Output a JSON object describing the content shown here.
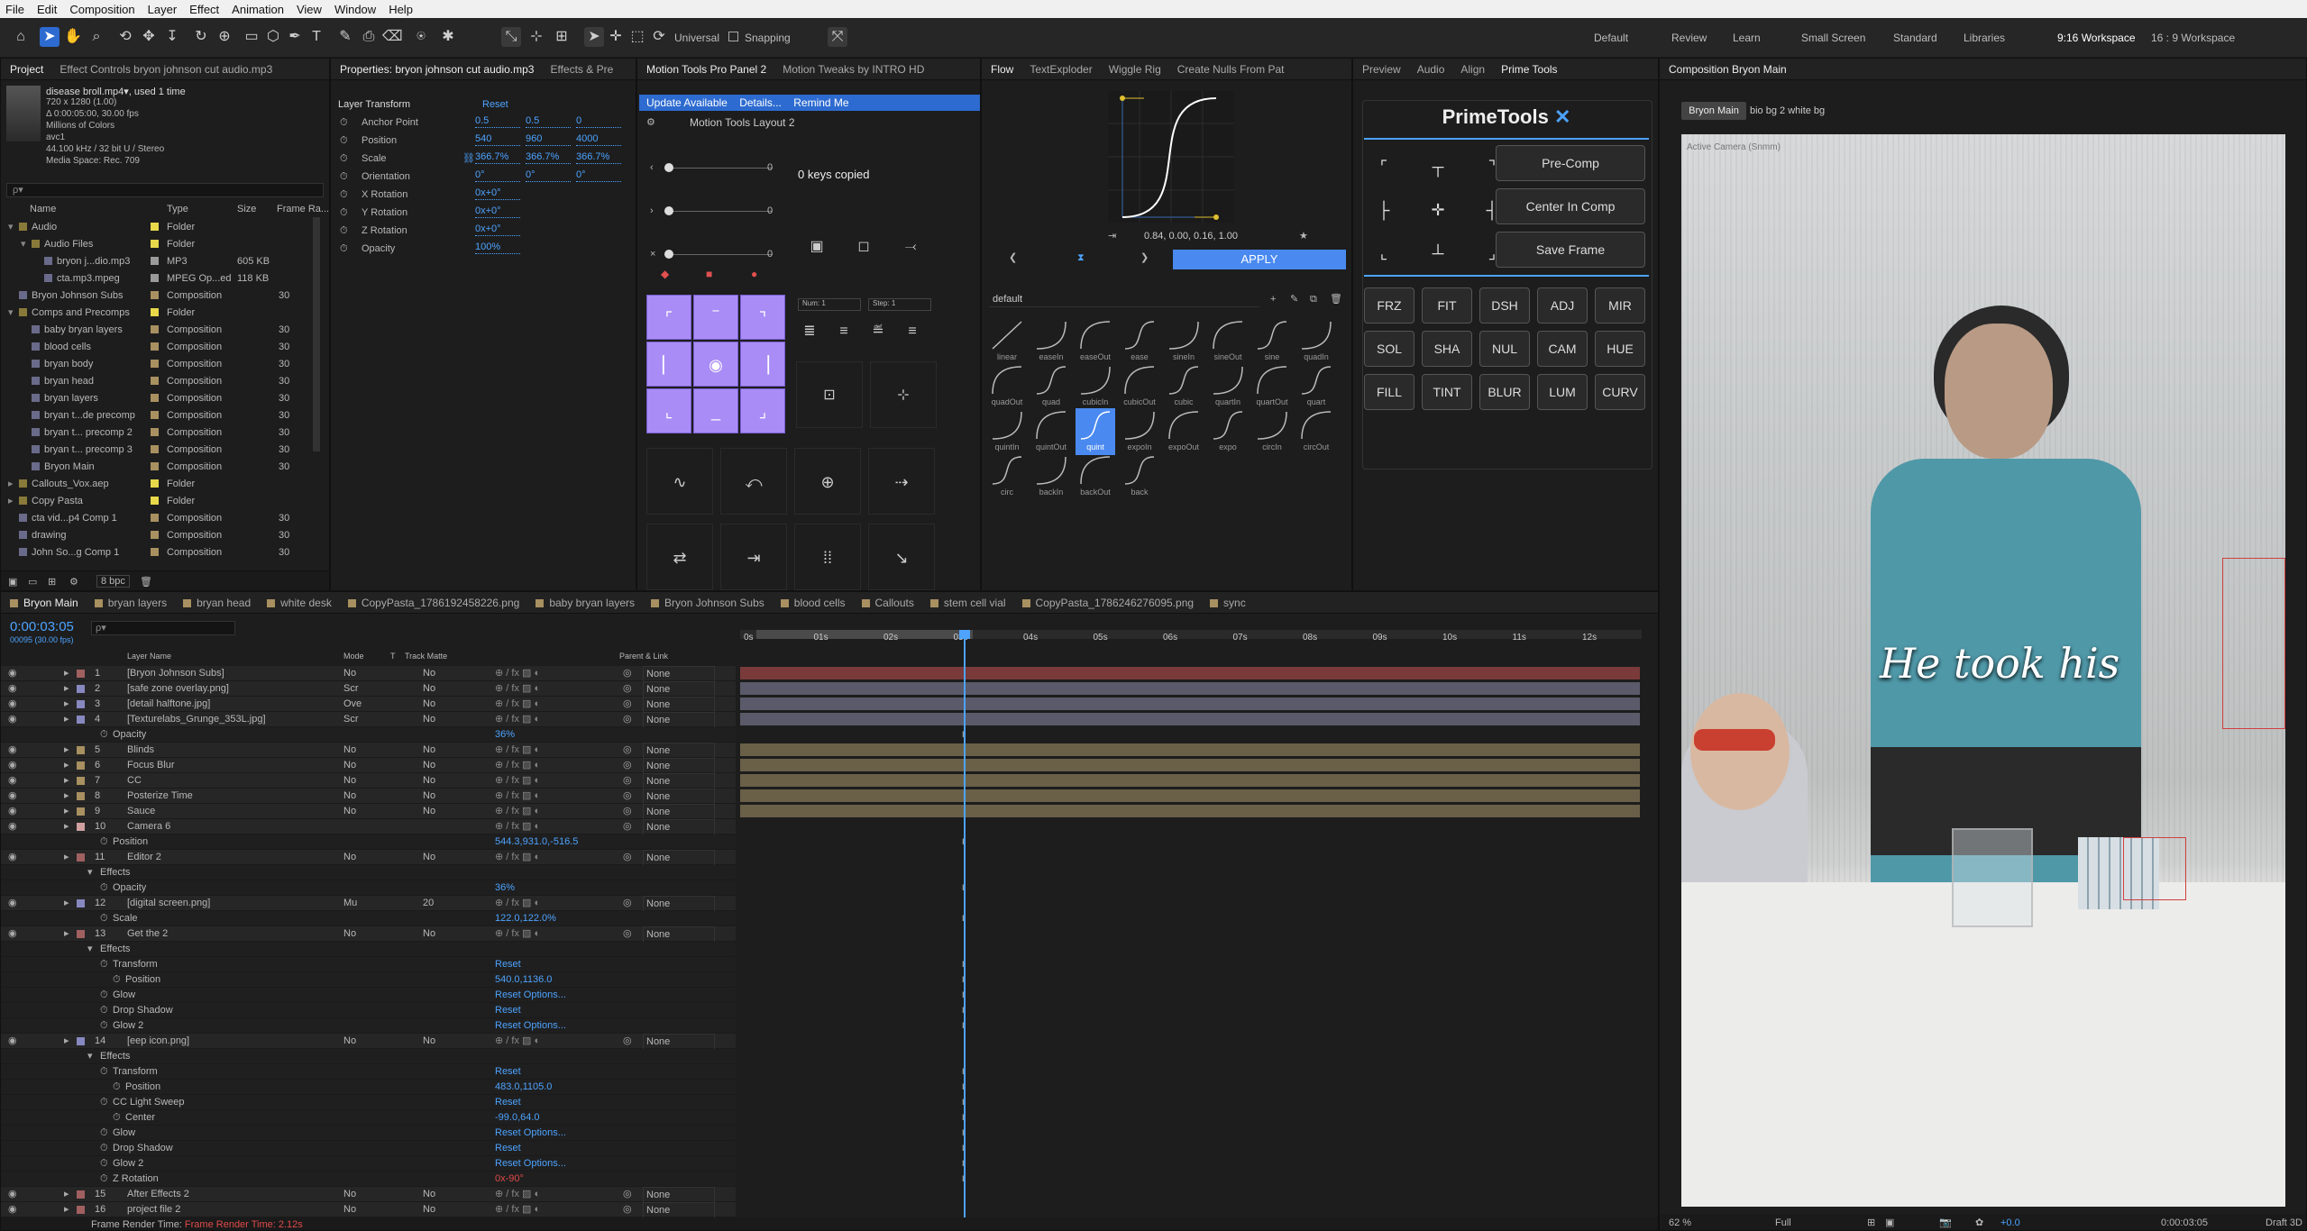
{
  "menu": [
    "File",
    "Edit",
    "Composition",
    "Layer",
    "Effect",
    "Animation",
    "View",
    "Window",
    "Help"
  ],
  "toolbar": {
    "universal": "Universal",
    "snapping": "Snapping",
    "workspaces": [
      "Default",
      "Review",
      "Learn",
      "Small Screen",
      "Standard",
      "Libraries",
      "9:16 Workspace",
      "16 : 9 Workspace"
    ],
    "active_workspace": "9:16 Workspace"
  },
  "project": {
    "tab": "Project",
    "effect_tab": "Effect Controls bryon johnson cut audio.mp3",
    "item_name": "disease broll.mp4▾, used 1 time",
    "item_info": [
      "720 x 1280 (1.00)",
      "Δ 0:00:05:00, 30.00 fps",
      "Millions of Colors",
      "avc1",
      "44.100 kHz / 32 bit U / Stereo",
      "Media Space: Rec. 709"
    ],
    "search_placeholder": "ρ▾",
    "cols": [
      "Name",
      "Type",
      "Size",
      "Frame Ra..."
    ],
    "items": [
      {
        "name": "Audio",
        "type": "Folder",
        "size": "",
        "fr": "",
        "indent": 0,
        "kind": "folder",
        "color": "#e8d84a"
      },
      {
        "name": "Audio Files",
        "type": "Folder",
        "size": "",
        "fr": "",
        "indent": 1,
        "kind": "folder",
        "color": "#e8d84a"
      },
      {
        "name": "bryon j...dio.mp3",
        "type": "MP3",
        "size": "605 KB",
        "fr": "",
        "indent": 2,
        "kind": "file",
        "color": "#9a9a9a"
      },
      {
        "name": "cta.mp3.mpeg",
        "type": "MPEG Op...ed",
        "size": "118 KB",
        "fr": "",
        "indent": 2,
        "kind": "file",
        "color": "#9a9a9a"
      },
      {
        "name": "Bryon Johnson Subs",
        "type": "Composition",
        "size": "",
        "fr": "30",
        "indent": 0,
        "kind": "comp",
        "color": "#a89060"
      },
      {
        "name": "Comps and Precomps",
        "type": "Folder",
        "size": "",
        "fr": "",
        "indent": 0,
        "kind": "folder",
        "color": "#e8d84a"
      },
      {
        "name": "baby bryan layers",
        "type": "Composition",
        "size": "",
        "fr": "30",
        "indent": 1,
        "kind": "comp",
        "color": "#a89060"
      },
      {
        "name": "blood cells",
        "type": "Composition",
        "size": "",
        "fr": "30",
        "indent": 1,
        "kind": "comp",
        "color": "#a89060"
      },
      {
        "name": "bryan body",
        "type": "Composition",
        "size": "",
        "fr": "30",
        "indent": 1,
        "kind": "comp",
        "color": "#a89060"
      },
      {
        "name": "bryan head",
        "type": "Composition",
        "size": "",
        "fr": "30",
        "indent": 1,
        "kind": "comp",
        "color": "#a89060"
      },
      {
        "name": "bryan layers",
        "type": "Composition",
        "size": "",
        "fr": "30",
        "indent": 1,
        "kind": "comp",
        "color": "#a89060"
      },
      {
        "name": "bryan t...de precomp",
        "type": "Composition",
        "size": "",
        "fr": "30",
        "indent": 1,
        "kind": "comp",
        "color": "#a89060"
      },
      {
        "name": "bryan t... precomp 2",
        "type": "Composition",
        "size": "",
        "fr": "30",
        "indent": 1,
        "kind": "comp",
        "color": "#a89060"
      },
      {
        "name": "bryan t... precomp 3",
        "type": "Composition",
        "size": "",
        "fr": "30",
        "indent": 1,
        "kind": "comp",
        "color": "#a89060"
      },
      {
        "name": "Bryon Main",
        "type": "Composition",
        "size": "",
        "fr": "30",
        "indent": 1,
        "kind": "comp",
        "color": "#a89060"
      },
      {
        "name": "Callouts_Vox.aep",
        "type": "Folder",
        "size": "",
        "fr": "",
        "indent": 0,
        "kind": "folder",
        "color": "#e8d84a"
      },
      {
        "name": "Copy Pasta",
        "type": "Folder",
        "size": "",
        "fr": "",
        "indent": 0,
        "kind": "folder",
        "color": "#e8d84a"
      },
      {
        "name": "cta vid...p4 Comp 1",
        "type": "Composition",
        "size": "",
        "fr": "30",
        "indent": 0,
        "kind": "comp",
        "color": "#a89060"
      },
      {
        "name": "drawing",
        "type": "Composition",
        "size": "",
        "fr": "30",
        "indent": 0,
        "kind": "comp",
        "color": "#a89060"
      },
      {
        "name": "John So...g Comp 1",
        "type": "Composition",
        "size": "",
        "fr": "30",
        "indent": 0,
        "kind": "comp",
        "color": "#a89060"
      }
    ],
    "bpc": "8 bpc"
  },
  "properties": {
    "tab": "Properties: bryon johnson cut audio.mp3",
    "tab2": "Effects & Pre",
    "section": "Layer Transform",
    "reset": "Reset",
    "rows": [
      {
        "label": "Anchor Point",
        "v": [
          "0.5",
          "0.5",
          "0"
        ]
      },
      {
        "label": "Position",
        "v": [
          "540",
          "960",
          "4000"
        ]
      },
      {
        "label": "Scale",
        "v": [
          "366.7%",
          "366.7%",
          "366.7%"
        ]
      },
      {
        "label": "Orientation",
        "v": [
          "0°",
          "0°",
          "0°"
        ]
      },
      {
        "label": "X Rotation",
        "v": [
          "0x+0°"
        ]
      },
      {
        "label": "Y Rotation",
        "v": [
          "0x+0°"
        ]
      },
      {
        "label": "Z Rotation",
        "v": [
          "0x+0°"
        ]
      },
      {
        "label": "Opacity",
        "v": [
          "100%"
        ]
      }
    ]
  },
  "motion": {
    "tabs": [
      "Motion Tools Pro Panel 2",
      "Motion Tweaks by INTRO HD"
    ],
    "update_text": "Update Available",
    "details": "Details...",
    "remind": "Remind Me",
    "layout": "Motion Tools Layout 2",
    "sliders": [
      "0",
      "0",
      "0"
    ],
    "keys_copied": "0 keys copied",
    "num": "Num: 1",
    "step": "Step: 1"
  },
  "flow": {
    "tabs": [
      "Flow",
      "TextExploder",
      "Wiggle Rig",
      "Create Nulls From Pat"
    ],
    "bezier": "0.84, 0.00, 0.16, 1.00",
    "apply": "APPLY",
    "preset": "default",
    "curves": [
      "linear",
      "easeIn",
      "easeOut",
      "ease",
      "sineIn",
      "sineOut",
      "sine",
      "quadIn",
      "quadOut",
      "quad",
      "cubicIn",
      "cubicOut",
      "cubic",
      "quartIn",
      "quartOut",
      "quart",
      "quintIn",
      "quintOut",
      "quint",
      "expoIn",
      "expoOut",
      "expo",
      "circIn",
      "circOut",
      "circ",
      "backIn",
      "backOut",
      "back"
    ],
    "selected": "quint"
  },
  "prime": {
    "tabs": [
      "Preview",
      "Audio",
      "Align",
      "Prime Tools"
    ],
    "title": "PrimeTools",
    "buttons": [
      "Pre-Comp",
      "Center In Comp",
      "Save Frame"
    ],
    "grid": [
      "FRZ",
      "FIT",
      "DSH",
      "ADJ",
      "MIR",
      "SOL",
      "SHA",
      "NUL",
      "CAM",
      "HUE",
      "FILL",
      "TINT",
      "BLUR",
      "LUM",
      "CURV"
    ]
  },
  "comp": {
    "tab": "Composition Bryon Main",
    "crumb1": "Bryon Main",
    "crumb2": "bio bg 2 white bg",
    "camera": "Active Camera (Snmm)",
    "caption": "He took his",
    "zoom": "62 %",
    "quality": "Full",
    "time": "0:00:03:05",
    "renderer": "Draft 3D",
    "exposure": "+0.0"
  },
  "timeline": {
    "tabs": [
      "Bryon Main",
      "bryan layers",
      "bryan head",
      "white desk",
      "CopyPasta_1786192458226.png",
      "baby bryan layers",
      "Bryon Johnson Subs",
      "blood cells",
      "Callouts",
      "stem cell vial",
      "CopyPasta_1786246276095.png",
      "sync"
    ],
    "timecode": "0:00:03:05",
    "frames": "00095 (30.00 fps)",
    "headers": [
      "Layer Name",
      "Mode",
      "T",
      "Track Matte",
      "Parent & Link"
    ],
    "ruler": [
      "0s",
      "01s",
      "02s",
      "03s",
      "04s",
      "05s",
      "06s",
      "07s",
      "08s",
      "09s",
      "10s",
      "11s",
      "12s"
    ],
    "render_time": "Frame Render Time: 2.12s",
    "rows": [
      {
        "n": "1",
        "name": "[Bryon Johnson Subs]",
        "c": "#a06060",
        "mode": "No",
        "tm": "No",
        "par": "None",
        "bar": "#7a3a3a",
        "lvl": 0
      },
      {
        "n": "2",
        "name": "[safe zone overlay.png]",
        "c": "#8888c0",
        "mode": "Scr",
        "tm": "No",
        "par": "None",
        "bar": "#5a5a6a",
        "lvl": 0
      },
      {
        "n": "3",
        "name": "[detail halftone.jpg]",
        "c": "#8888c0",
        "mode": "Ove",
        "tm": "No",
        "par": "None",
        "bar": "#5a5a6a",
        "lvl": 0
      },
      {
        "n": "4",
        "name": "[Texturelabs_Grunge_353L.jpg]",
        "c": "#8888c0",
        "mode": "Scr",
        "tm": "No",
        "par": "None",
        "bar": "#5a5a6a",
        "lvl": 0
      },
      {
        "n": "",
        "name": "Opacity",
        "val": "36%",
        "lvl": 2
      },
      {
        "n": "5",
        "name": "Blinds",
        "c": "#a89060",
        "mode": "No",
        "tm": "No",
        "par": "None",
        "bar": "#6a6048",
        "lvl": 0
      },
      {
        "n": "6",
        "name": "Focus Blur",
        "c": "#a89060",
        "mode": "No",
        "tm": "No",
        "par": "None",
        "bar": "#6a6048",
        "lvl": 0
      },
      {
        "n": "7",
        "name": "CC",
        "c": "#a89060",
        "mode": "No",
        "tm": "No",
        "par": "None",
        "bar": "#6a6048",
        "lvl": 0
      },
      {
        "n": "8",
        "name": "Posterize Time",
        "c": "#a89060",
        "mode": "No",
        "tm": "No",
        "par": "None",
        "bar": "#6a6048",
        "lvl": 0
      },
      {
        "n": "9",
        "name": "Sauce",
        "c": "#a89060",
        "mode": "No",
        "tm": "No",
        "par": "None",
        "bar": "#6a6048",
        "lvl": 0
      },
      {
        "n": "10",
        "name": "Camera 6",
        "c": "#d0a0a0",
        "mode": "",
        "tm": "",
        "par": "None",
        "bar": "",
        "lvl": 0
      },
      {
        "n": "",
        "name": "Position",
        "val": "544.3,931.0,-516.5",
        "lvl": 2
      },
      {
        "n": "11",
        "name": "Editor 2",
        "c": "#a06060",
        "mode": "No",
        "tm": "No",
        "par": "None",
        "bar": "",
        "lvl": 0
      },
      {
        "n": "",
        "name": "Effects",
        "lvl": 1
      },
      {
        "n": "",
        "name": "Opacity",
        "val": "36%",
        "lvl": 2
      },
      {
        "n": "12",
        "name": "[digital screen.png]",
        "c": "#8888c0",
        "mode": "Mu",
        "tm": "20",
        "par": "None",
        "bar": "",
        "lvl": 0
      },
      {
        "n": "",
        "name": "Scale",
        "val": "122.0,122.0%",
        "lvl": 2
      },
      {
        "n": "13",
        "name": "Get the 2",
        "c": "#a06060",
        "mode": "No",
        "tm": "No",
        "par": "None",
        "bar": "",
        "lvl": 0
      },
      {
        "n": "",
        "name": "Effects",
        "lvl": 1
      },
      {
        "n": "",
        "name": "Transform",
        "val": "Reset",
        "lvl": 2
      },
      {
        "n": "",
        "name": "Position",
        "val": "540.0,1136.0",
        "lvl": 3
      },
      {
        "n": "",
        "name": "Glow",
        "val": "Reset   Options...",
        "lvl": 2
      },
      {
        "n": "",
        "name": "Drop Shadow",
        "val": "Reset",
        "lvl": 2
      },
      {
        "n": "",
        "name": "Glow 2",
        "val": "Reset   Options...",
        "lvl": 2
      },
      {
        "n": "14",
        "name": "[eep icon.png]",
        "c": "#8888c0",
        "mode": "No",
        "tm": "No",
        "par": "None",
        "bar": "",
        "lvl": 0
      },
      {
        "n": "",
        "name": "Effects",
        "lvl": 1
      },
      {
        "n": "",
        "name": "Transform",
        "val": "Reset",
        "lvl": 2
      },
      {
        "n": "",
        "name": "Position",
        "val": "483.0,1105.0",
        "lvl": 3
      },
      {
        "n": "",
        "name": "CC Light Sweep",
        "val": "Reset",
        "lvl": 2
      },
      {
        "n": "",
        "name": "Center",
        "val": "-99.0,64.0",
        "lvl": 3
      },
      {
        "n": "",
        "name": "Glow",
        "val": "Reset   Options...",
        "lvl": 2
      },
      {
        "n": "",
        "name": "Drop Shadow",
        "val": "Reset",
        "lvl": 2
      },
      {
        "n": "",
        "name": "Glow 2",
        "val": "Reset   Options...",
        "lvl": 2
      },
      {
        "n": "",
        "name": "Z Rotation",
        "val": "0x-90°",
        "lvl": 2,
        "redv": true
      },
      {
        "n": "15",
        "name": "After Effects 2",
        "c": "#a06060",
        "mode": "No",
        "tm": "No",
        "par": "None",
        "bar": "",
        "lvl": 0
      },
      {
        "n": "16",
        "name": "project file 2",
        "c": "#a06060",
        "mode": "No",
        "tm": "No",
        "par": "None",
        "bar": "",
        "lvl": 0
      }
    ]
  }
}
